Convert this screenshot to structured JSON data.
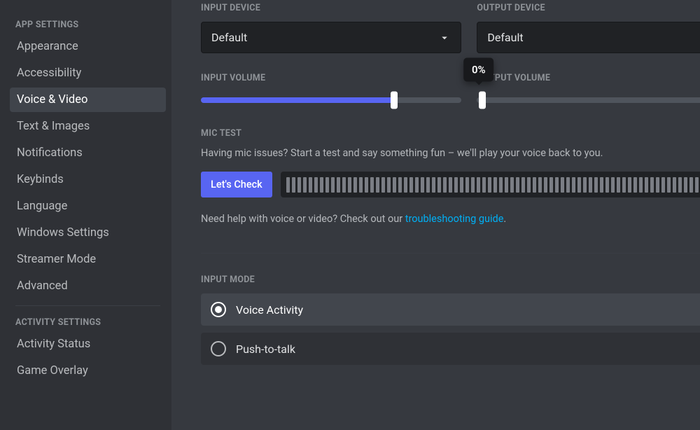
{
  "sidebar": {
    "sections": [
      {
        "header": "APP SETTINGS",
        "items": [
          {
            "label": "Appearance"
          },
          {
            "label": "Accessibility"
          },
          {
            "label": "Voice & Video"
          },
          {
            "label": "Text & Images"
          },
          {
            "label": "Notifications"
          },
          {
            "label": "Keybinds"
          },
          {
            "label": "Language"
          },
          {
            "label": "Windows Settings"
          },
          {
            "label": "Streamer Mode"
          },
          {
            "label": "Advanced"
          }
        ]
      },
      {
        "header": "ACTIVITY SETTINGS",
        "items": [
          {
            "label": "Activity Status"
          },
          {
            "label": "Game Overlay"
          }
        ]
      }
    ]
  },
  "devices": {
    "input_label": "INPUT DEVICE",
    "input_value": "Default",
    "output_label": "OUTPUT DEVICE",
    "output_value": "Default"
  },
  "volumes": {
    "input_label": "INPUT VOLUME",
    "input_percent": 74,
    "output_label": "OUTPUT VOLUME",
    "output_percent": 0,
    "tooltip_text": "0%"
  },
  "mic_test": {
    "header": "MIC TEST",
    "description": "Having mic issues? Start a test and say something fun – we'll play your voice back to you.",
    "button_label": "Let's Check",
    "help_prefix": "Need help with voice or video? Check out our ",
    "help_link_text": "troubleshooting guide",
    "help_suffix": "."
  },
  "input_mode": {
    "header": "INPUT MODE",
    "options": [
      {
        "label": "Voice Activity",
        "selected": true
      },
      {
        "label": "Push-to-talk",
        "selected": false
      }
    ]
  }
}
